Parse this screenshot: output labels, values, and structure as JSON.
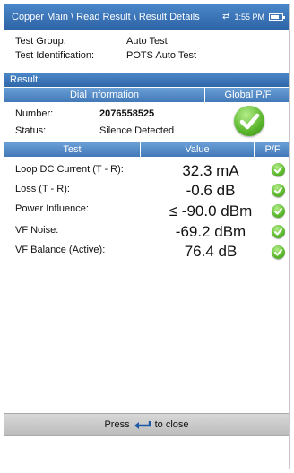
{
  "titlebar": {
    "breadcrumb": "Copper Main \\ Read Result \\ Result Details",
    "sync_icon": "⇄",
    "time": "1:55 PM",
    "battery_level": 0.8
  },
  "info": [
    {
      "label": "Test Group:",
      "value": "Auto Test"
    },
    {
      "label": "Test Identification:",
      "value": "POTS Auto Test"
    }
  ],
  "result_bar": "Result:",
  "dial_header": {
    "left": "Dial Information",
    "right": "Global P/F"
  },
  "dial": [
    {
      "label": "Number:",
      "value": "2076558525"
    },
    {
      "label": "Status:",
      "value": "Silence Detected"
    }
  ],
  "global_pf": "pass",
  "table_header": {
    "test": "Test",
    "value": "Value",
    "pf": "P/F"
  },
  "tests": [
    {
      "label": "Loop DC Current (T - R):",
      "value": "32.3 mA",
      "pf": "pass"
    },
    {
      "label": "Loss (T - R):",
      "value": "-0.6 dB",
      "pf": "pass"
    },
    {
      "label": "Power Influence:",
      "value": "≤ -90.0 dBm",
      "pf": "pass"
    },
    {
      "label": "VF Noise:",
      "value": "-69.2 dBm",
      "pf": "pass"
    },
    {
      "label": "VF Balance (Active):",
      "value": "76.4 dB",
      "pf": "pass"
    }
  ],
  "footer": {
    "prefix": "Press",
    "suffix": "to close",
    "icon": "enter-arrow-icon"
  },
  "colors": {
    "header_blue": "#2d64a6",
    "pass_green": "#59b52b"
  }
}
